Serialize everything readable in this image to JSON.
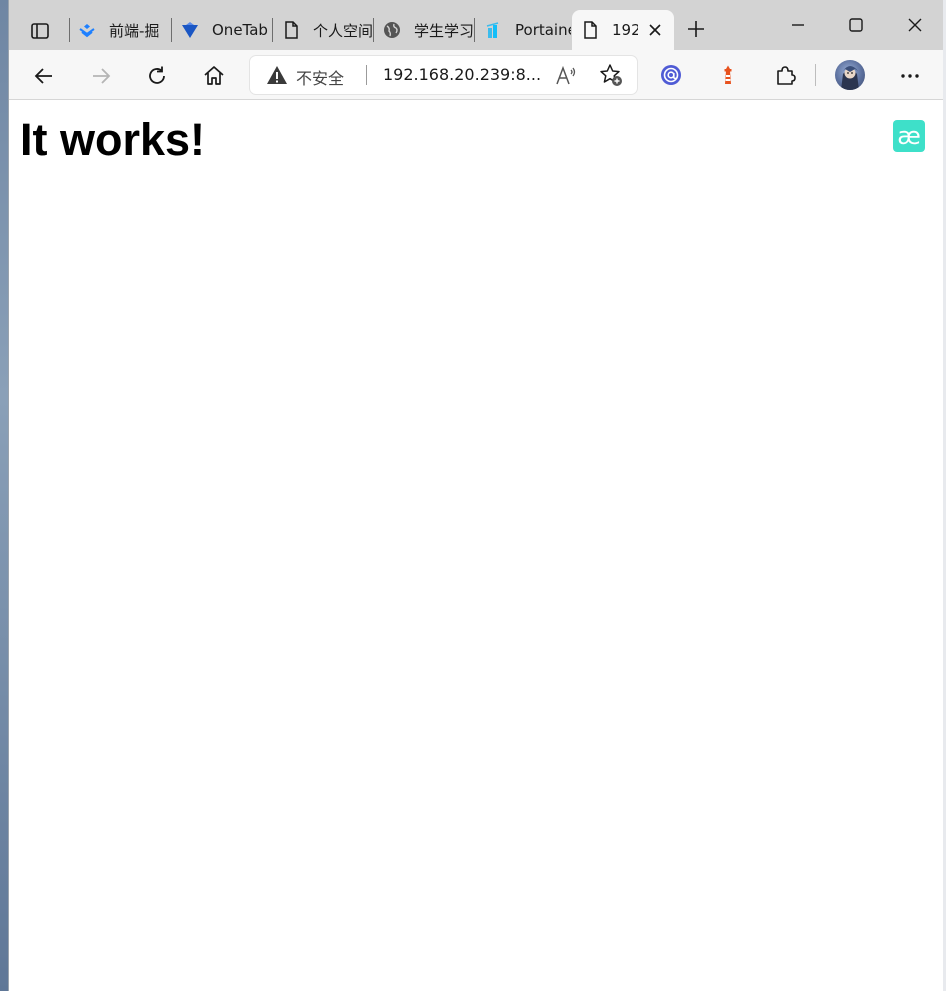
{
  "tabs": [
    {
      "label": "前端-掘",
      "icon": "juejin-icon"
    },
    {
      "label": "OneTab",
      "icon": "onetab-icon"
    },
    {
      "label": "个人空间",
      "icon": "page-icon"
    },
    {
      "label": "学生学习",
      "icon": "globe-icon"
    },
    {
      "label": "Portainer",
      "icon": "portainer-icon"
    },
    {
      "label": "192",
      "icon": "page-icon",
      "active": true
    }
  ],
  "address_bar": {
    "security_label": "不安全",
    "url": "192.168.20.239:8..."
  },
  "page": {
    "heading": "It works!",
    "badge": "æ"
  },
  "colors": {
    "tabstrip": "#d3d3d3",
    "toolbar": "#f7f7f7",
    "badge": "#3ee0c9",
    "ext_blue": "#4f5bd5",
    "ext_orange": "#e8521e"
  }
}
